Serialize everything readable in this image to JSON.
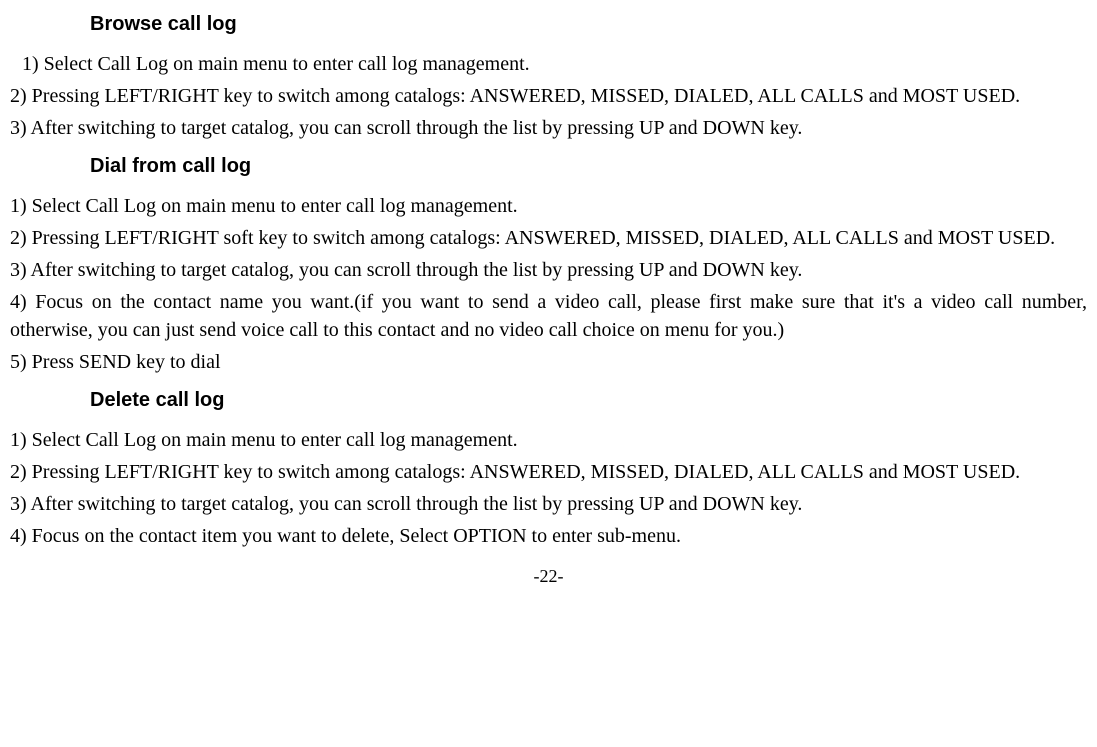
{
  "sections": {
    "browse": {
      "heading": "Browse call log",
      "items": [
        "1)    Select Call Log on main menu to enter call log management.",
        "2)    Pressing LEFT/RIGHT key to switch among catalogs: ANSWERED, MISSED, DIALED, ALL CALLS and MOST USED.",
        "3)    After switching to target catalog, you can scroll through the list by pressing UP and DOWN key."
      ]
    },
    "dial": {
      "heading": "Dial from call log",
      "items": [
        "1)    Select Call Log on main menu to enter call log management.",
        "2) Pressing LEFT/RIGHT soft key to switch among catalogs: ANSWERED, MISSED, DIALED, ALL CALLS and MOST USED.",
        "3)    After switching to target catalog, you can scroll through the list by pressing UP and DOWN key.",
        "4)    Focus on the contact name you want.(if you want to send a video call, please first make sure that it's a video call number, otherwise, you can just send voice call to this contact and no video call choice on menu for you.)",
        "5)    Press SEND key to dial"
      ]
    },
    "delete": {
      "heading": "Delete call log",
      "items": [
        "1)    Select Call Log on main menu to enter call log management.",
        "2)    Pressing LEFT/RIGHT key to switch among catalogs: ANSWERED, MISSED, DIALED, ALL CALLS and MOST USED.",
        "3)    After switching to target catalog, you can scroll through the list by pressing UP and DOWN key.",
        "4)    Focus on the contact item you want to delete, Select OPTION to enter sub-menu."
      ]
    }
  },
  "page_number": "-22-"
}
